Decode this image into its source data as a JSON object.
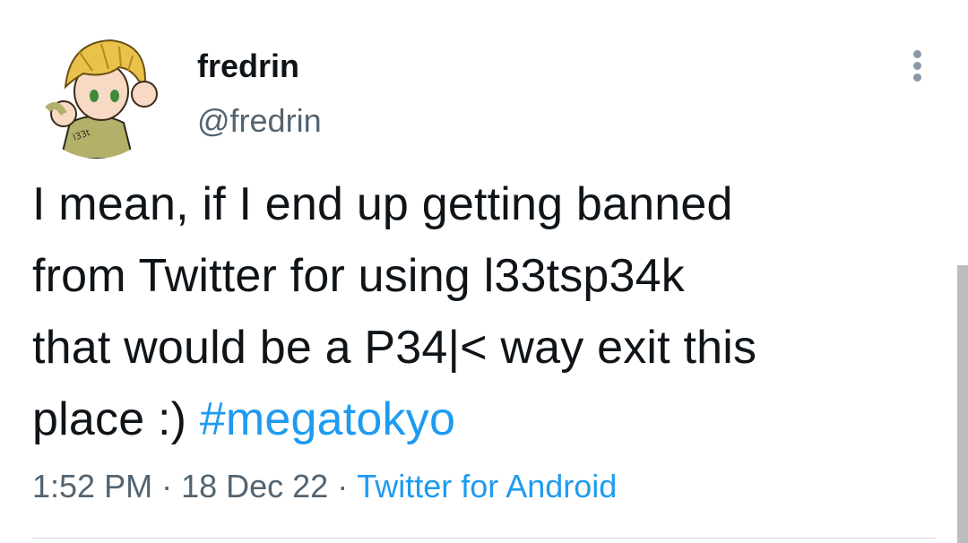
{
  "tweet": {
    "author": {
      "display_name": "fredrin",
      "handle": "@fredrin",
      "avatar_icon": "anime-character-avatar"
    },
    "text_lines": [
      "I mean, if I end up getting banned",
      "from Twitter for using l33tsp34k",
      "that would be a P34|< way exit this",
      "place :)"
    ],
    "hashtag": "#megatokyo",
    "time": "1:52 PM",
    "date": "18 Dec 22",
    "source": "Twitter for Android",
    "separator": "·",
    "more_icon": "more-vertical-icon"
  },
  "colors": {
    "text": "#0f1419",
    "secondary": "#536471",
    "link": "#1d9bf0",
    "divider": "#cfd9de"
  }
}
